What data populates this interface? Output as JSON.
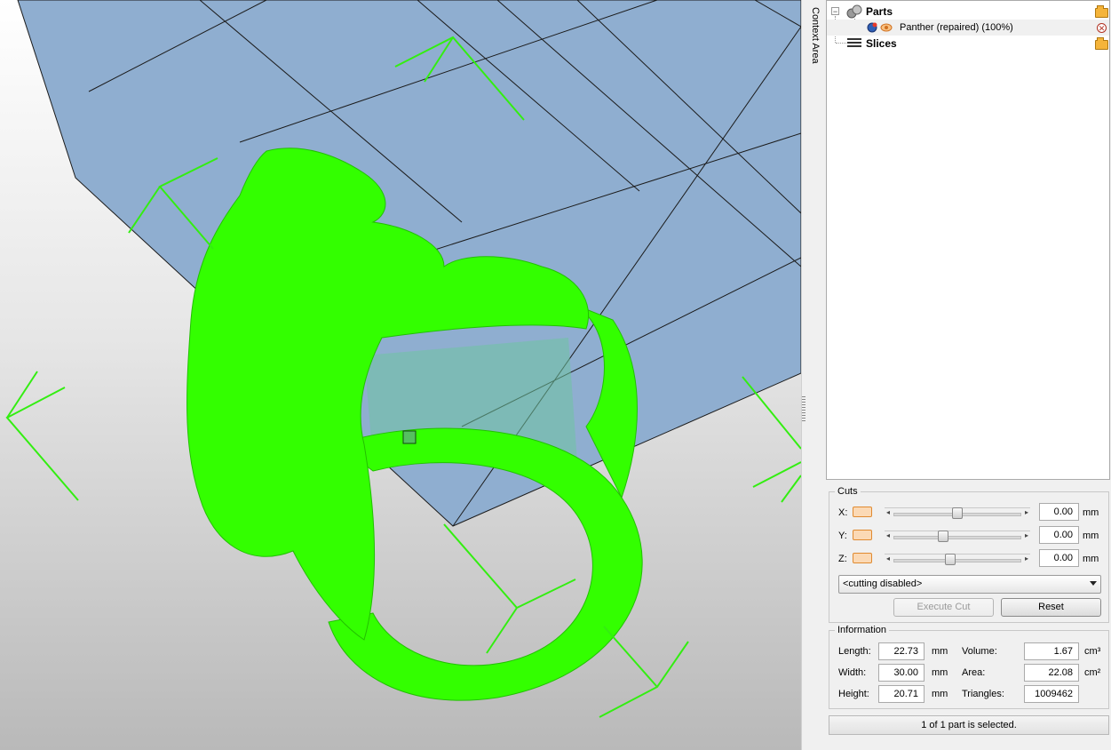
{
  "viewport": {
    "model_color": "#33ff00",
    "plate_color": "#8faed0",
    "gizmo_color": "#33ee11"
  },
  "sidebar": {
    "context_area_label": "Context Area"
  },
  "tree": {
    "parts_label": "Parts",
    "part_item_label": "Panther (repaired) (100%)",
    "slices_label": "Slices"
  },
  "cuts": {
    "title": "Cuts",
    "x": {
      "label": "X:",
      "value": "0.00",
      "unit": "mm",
      "slider_position": 0.5
    },
    "y": {
      "label": "Y:",
      "value": "0.00",
      "unit": "mm",
      "slider_position": 0.38
    },
    "z": {
      "label": "Z:",
      "value": "0.00",
      "unit": "mm",
      "slider_position": 0.44
    },
    "mode_selected": "<cutting disabled>",
    "execute_label": "Execute Cut",
    "reset_label": "Reset"
  },
  "information": {
    "title": "Information",
    "length_label": "Length:",
    "length_value": "22.73",
    "length_unit": "mm",
    "width_label": "Width:",
    "width_value": "30.00",
    "width_unit": "mm",
    "height_label": "Height:",
    "height_value": "20.71",
    "height_unit": "mm",
    "volume_label": "Volume:",
    "volume_value": "1.67",
    "volume_unit": "cm³",
    "area_label": "Area:",
    "area_value": "22.08",
    "area_unit": "cm²",
    "triangles_label": "Triangles:",
    "triangles_value": "1009462"
  },
  "status": {
    "text": "1 of 1 part is selected."
  }
}
